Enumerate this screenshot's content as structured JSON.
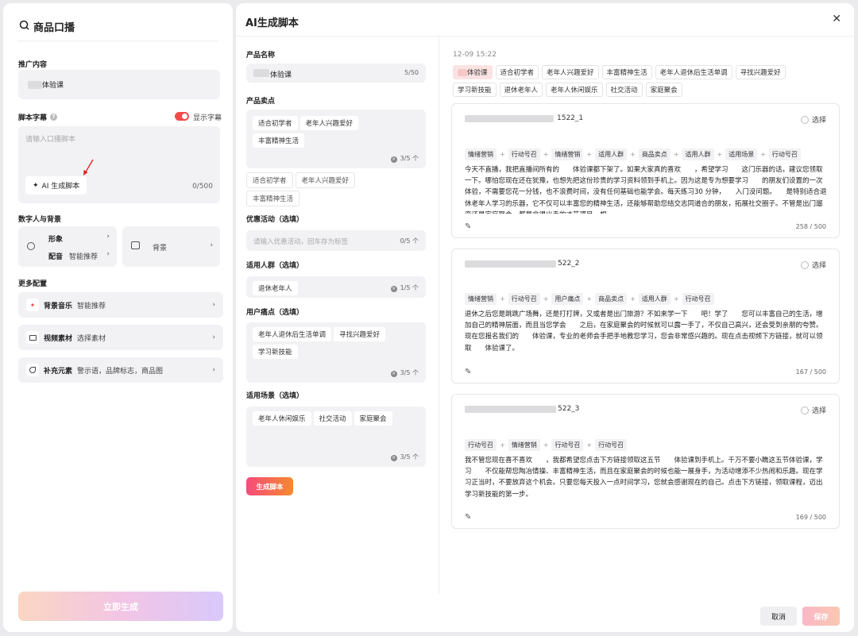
{
  "left": {
    "title": "商品口播",
    "promo_label": "推广内容",
    "product": "体验课",
    "script_label": "脚本字幕",
    "subtitle_toggle": "显示字幕",
    "script_placeholder": "请输入口播脚本",
    "ai_script_btn": "AI 生成脚本",
    "script_count": "0/500",
    "digital_label": "数字人与背景",
    "image": "形象",
    "voice": "配音",
    "voice_value": "智能推荐",
    "background": "背景",
    "more_label": "更多配置",
    "bgm": "背景音乐",
    "bgm_value": "智能推荐",
    "video": "视频素材",
    "video_value": "选择素材",
    "extra": "补充元素",
    "extra_value": "警示语，品牌标志，商品图",
    "generate_now": "立即生成"
  },
  "main": {
    "title": "AI生成脚本",
    "product_name_label": "产品名称",
    "product_name": "体验课",
    "product_name_count": "5/50",
    "selling_label": "产品卖点",
    "selling_chips": [
      "适合初学者",
      "老年人兴趣爱好",
      "丰富精神生活"
    ],
    "selling_count": "3/5 个",
    "selling_options": [
      "适合初学者",
      "老年人兴趣爱好",
      "丰富精神生活"
    ],
    "promo_label": "优惠活动（选填）",
    "promo_placeholder": "请输入优惠活动，回车存为标签",
    "promo_count": "0/5 个",
    "crowd_label": "适用人群（选填）",
    "crowd_chips": [
      "退休老年人"
    ],
    "crowd_count": "1/5 个",
    "pain_label": "用户痛点（选填）",
    "pain_chips": [
      "老年人退休后生活单调",
      "寻找兴趣爱好",
      "学习新技能"
    ],
    "pain_count": "3/5 个",
    "scene_label": "适用场景（选填）",
    "scene_chips": [
      "老年人休闲娱乐",
      "社交活动",
      "家庭聚会"
    ],
    "scene_count": "3/5 个",
    "gen_script_btn": "生成脚本"
  },
  "results": {
    "timestamp": "12-09  15:22",
    "tags": [
      "体验课",
      "适合初学者",
      "老年人兴趣爱好",
      "丰富精神生活",
      "老年人退休后生活单调",
      "寻找兴趣爱好",
      "学习新技能",
      "退休老年人",
      "老年人休闲娱乐",
      "社交活动",
      "家庭聚会"
    ],
    "select_label": "选择",
    "cards": [
      {
        "id": "1522_1",
        "tags": [
          "情绪营销",
          "行动号召",
          "情绪营销",
          "适用人群",
          "商品卖点",
          "适用人群",
          "适用场景",
          "行动号召"
        ],
        "text": "今天不直播，我把直播间所有的　　体验课都下架了。如果大家真的喜欢　　，希望学习　　这门乐器的话，建议您领取一下。哪怕您现在还在犹豫，也想先把这份珍贵的学习资料领到手机上。因为这是专为想要学习　　的朋友们设置的一次体验，不需要您花一分钱，也不浪费时间，没有任何基础也能学会。每天练习30 分钟，　　入门没问题。　　是特别适合退休老年人学习的乐器，它不仅可以丰富您的精神生活，还能够帮助您结交志同道合的朋友，拓展社交圈子。不管是出门遛弯还是家庭聚会，都是拿得出手的才艺项目。想",
        "count": "258 / 500"
      },
      {
        "id": "522_2",
        "tags": [
          "情绪营销",
          "行动号召",
          "用户痛点",
          "商品卖点",
          "适用人群",
          "行动号召"
        ],
        "text": "退休之后您是跳跳广场舞，还是打打牌，又或者是出门旅游？不如来学一下　　吧！学了　　您可以丰富自己的生活，增加自己的精神层面，而且当您学会　　之后，在家庭聚会的时候就可以露一手了，不仅自己高兴，还会受到亲朋的夸赞。现在您报名我们的　　体验课，专业的老师会手把手地教您学习，您会非常感兴趣的。现在点击视频下方链接，就可以领取　　体验课了。",
        "count": "167 / 500"
      },
      {
        "id": "522_3",
        "tags": [
          "行动号召",
          "情绪营销",
          "行动号召",
          "行动号召"
        ],
        "text": "我不管您现在喜不喜欢　　，我都希望您点击下方链接领取这五节　　体验课到手机上。千万不要小瞧这五节体验课，学习　　不仅能帮您陶冶情操、丰富精神生活，而且在家庭聚会的时候也能一展身手，为活动增添不少热闹和乐趣。现在学习正当时，不要放弃这个机会。只要您每天投入一点时间学习，您就会感谢现在的自己。点击下方链接，领取课程，迈出学习新技能的第一步。",
        "count": "169 / 500"
      }
    ]
  },
  "footer": {
    "cancel": "取消",
    "save": "保存"
  }
}
